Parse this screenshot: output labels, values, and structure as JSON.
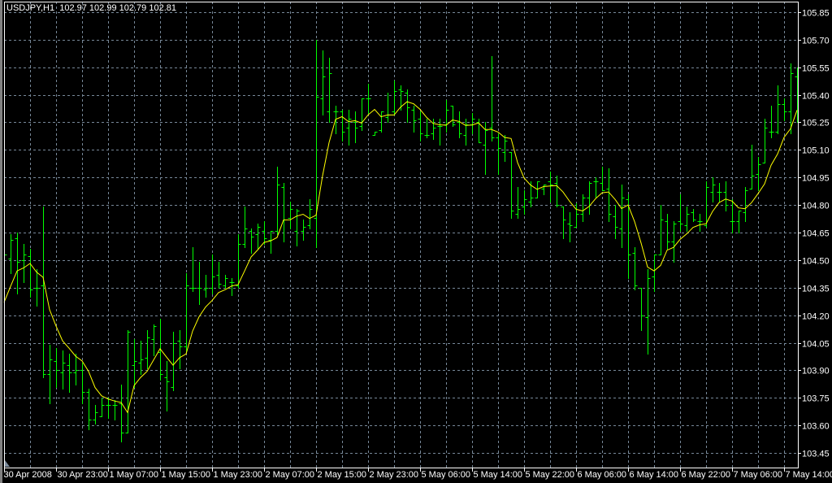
{
  "header": {
    "symbol_label": "USDJPY,H1",
    "ohlc_readout": "102.97 102.99 102.79 102.81"
  },
  "colors": {
    "background": "#000000",
    "bars": "#00ff00",
    "ma": "#ffff00",
    "grid": "#778899",
    "axis": "#ffffff"
  },
  "chart_data": {
    "type": "ohlc",
    "title": "USDJPY,H1",
    "timeframe": "H1",
    "ylim": [
      103.45,
      105.85
    ],
    "yticks": [
      "105.85",
      "105.70",
      "105.55",
      "105.40",
      "105.25",
      "105.10",
      "104.95",
      "104.80",
      "104.65",
      "104.50",
      "104.35",
      "104.20",
      "104.05",
      "103.90",
      "103.75",
      "103.60",
      "103.45"
    ],
    "xtick_labels": [
      "30 Apr 2008",
      "30 Apr 23:00",
      "1 May 07:00",
      "1 May 15:00",
      "1 May 23:00",
      "2 May 07:00",
      "2 May 15:00",
      "2 May 23:00",
      "5 May 06:00",
      "5 May 14:00",
      "5 May 22:00",
      "6 May 06:00",
      "6 May 14:00",
      "6 May 22:00",
      "7 May 06:00",
      "7 May 14:00"
    ],
    "xtick_every_bars": 8,
    "grid": true,
    "bar_fields": [
      "open",
      "high",
      "low",
      "close"
    ],
    "bars": [
      [
        104.59,
        104.64,
        104.43,
        104.53
      ],
      [
        104.51,
        104.64,
        104.43,
        104.61
      ],
      [
        104.62,
        104.65,
        104.32,
        104.49
      ],
      [
        104.5,
        104.59,
        104.38,
        104.53
      ],
      [
        104.52,
        104.56,
        104.3,
        104.34
      ],
      [
        104.35,
        104.45,
        104.25,
        104.35
      ],
      [
        104.36,
        104.79,
        103.86,
        103.88
      ],
      [
        103.88,
        104.04,
        103.72,
        103.96
      ],
      [
        103.95,
        104.02,
        103.81,
        103.9
      ],
      [
        103.89,
        104.01,
        103.8,
        103.94
      ],
      [
        103.93,
        103.99,
        103.78,
        103.89
      ],
      [
        103.89,
        103.99,
        103.82,
        103.9
      ],
      [
        103.9,
        103.94,
        103.72,
        103.78
      ],
      [
        103.78,
        103.8,
        103.58,
        103.63
      ],
      [
        103.63,
        103.71,
        103.61,
        103.67
      ],
      [
        103.65,
        103.75,
        103.65,
        103.71
      ],
      [
        103.71,
        103.75,
        103.64,
        103.71
      ],
      [
        103.71,
        103.74,
        103.63,
        103.71
      ],
      [
        103.72,
        103.82,
        103.51,
        103.56
      ],
      [
        103.56,
        104.12,
        103.56,
        104.11
      ],
      [
        103.93,
        104.07,
        103.81,
        103.95
      ],
      [
        103.94,
        104.06,
        103.88,
        103.96
      ],
      [
        103.97,
        104.12,
        103.91,
        104.08
      ],
      [
        104.07,
        104.15,
        103.98,
        104.14
      ],
      [
        104.0,
        104.18,
        103.85,
        103.88
      ],
      [
        103.86,
        103.95,
        103.68,
        103.84
      ],
      [
        103.81,
        104.11,
        103.79,
        104.05
      ],
      [
        104.06,
        104.12,
        103.91,
        104.03
      ],
      [
        104.03,
        104.43,
        104.0,
        104.36
      ],
      [
        104.35,
        104.57,
        104.33,
        104.35
      ],
      [
        104.35,
        104.49,
        104.26,
        104.35
      ],
      [
        104.34,
        104.42,
        104.3,
        104.35
      ],
      [
        104.35,
        104.53,
        104.32,
        104.41
      ],
      [
        104.42,
        104.49,
        104.35,
        104.37
      ],
      [
        104.36,
        104.42,
        104.35,
        104.4
      ],
      [
        104.38,
        104.4,
        104.31,
        104.38
      ],
      [
        104.36,
        104.64,
        104.35,
        104.59
      ],
      [
        104.59,
        104.79,
        104.57,
        104.67
      ],
      [
        104.66,
        104.67,
        104.54,
        104.63
      ],
      [
        104.64,
        104.7,
        104.56,
        104.68
      ],
      [
        104.66,
        104.71,
        104.59,
        104.62
      ],
      [
        104.61,
        104.66,
        104.54,
        104.66
      ],
      [
        104.66,
        105.01,
        104.64,
        104.91
      ],
      [
        104.9,
        104.92,
        104.6,
        104.72
      ],
      [
        104.73,
        104.82,
        104.67,
        104.78
      ],
      [
        104.66,
        104.78,
        104.58,
        104.77
      ],
      [
        104.66,
        104.72,
        104.61,
        104.68
      ],
      [
        104.69,
        104.83,
        104.67,
        104.78
      ],
      [
        104.73,
        105.7,
        104.57,
        105.39
      ],
      [
        105.38,
        105.64,
        105.29,
        105.5
      ],
      [
        105.31,
        105.6,
        105.25,
        105.52
      ],
      [
        105.31,
        105.34,
        105.19,
        105.31
      ],
      [
        105.31,
        105.32,
        105.15,
        105.2
      ],
      [
        105.22,
        105.32,
        105.13,
        105.27
      ],
      [
        105.25,
        105.31,
        105.14,
        105.22
      ],
      [
        105.23,
        105.38,
        105.21,
        105.38
      ],
      [
        105.38,
        105.46,
        105.3,
        105.38
      ],
      [
        105.18,
        105.2,
        105.18,
        105.2
      ],
      [
        105.21,
        105.31,
        105.2,
        105.31
      ],
      [
        105.28,
        105.41,
        105.25,
        105.29
      ],
      [
        105.31,
        105.48,
        105.29,
        105.42
      ],
      [
        105.43,
        105.45,
        105.32,
        105.42
      ],
      [
        105.41,
        105.43,
        105.25,
        105.33
      ],
      [
        105.32,
        105.34,
        105.2,
        105.26
      ],
      [
        105.27,
        105.31,
        105.15,
        105.19
      ],
      [
        105.18,
        105.27,
        105.17,
        105.18
      ],
      [
        105.19,
        105.27,
        105.16,
        105.22
      ],
      [
        105.23,
        105.27,
        105.13,
        105.23
      ],
      [
        105.24,
        105.37,
        105.2,
        105.32
      ],
      [
        105.34,
        105.34,
        105.23,
        105.24
      ],
      [
        105.25,
        105.31,
        105.17,
        105.19
      ],
      [
        105.18,
        105.27,
        105.13,
        105.24
      ],
      [
        105.24,
        105.3,
        105.19,
        105.27
      ],
      [
        105.25,
        105.27,
        105.14,
        105.14
      ],
      [
        105.13,
        105.25,
        104.97,
        105.21
      ],
      [
        105.22,
        105.61,
        105.15,
        105.17
      ],
      [
        105.17,
        105.19,
        104.97,
        105.11
      ],
      [
        105.09,
        105.18,
        105.04,
        105.15
      ],
      [
        105.09,
        105.09,
        104.73,
        104.77
      ],
      [
        104.75,
        104.9,
        104.73,
        104.78
      ],
      [
        104.79,
        104.88,
        104.75,
        104.83
      ],
      [
        104.82,
        104.93,
        104.79,
        104.84
      ],
      [
        104.84,
        104.93,
        104.84,
        104.93
      ],
      [
        104.89,
        104.91,
        104.86,
        104.91
      ],
      [
        104.93,
        104.98,
        104.82,
        104.91
      ],
      [
        104.92,
        104.96,
        104.79,
        104.8
      ],
      [
        104.79,
        104.79,
        104.62,
        104.72
      ],
      [
        104.7,
        104.76,
        104.6,
        104.69
      ],
      [
        104.68,
        104.81,
        104.68,
        104.75
      ],
      [
        104.75,
        104.86,
        104.71,
        104.84
      ],
      [
        104.84,
        104.93,
        104.75,
        104.92
      ],
      [
        104.93,
        104.95,
        104.84,
        104.93
      ],
      [
        104.92,
        105.01,
        104.88,
        104.88
      ],
      [
        104.89,
        105.0,
        104.71,
        104.75
      ],
      [
        104.74,
        104.8,
        104.62,
        104.68
      ],
      [
        104.67,
        104.91,
        104.57,
        104.84
      ],
      [
        104.83,
        104.86,
        104.4,
        104.53
      ],
      [
        104.54,
        104.57,
        104.34,
        104.36
      ],
      [
        104.35,
        104.35,
        104.12,
        104.2
      ],
      [
        104.19,
        104.45,
        103.99,
        104.4
      ],
      [
        104.41,
        104.53,
        104.33,
        104.53
      ],
      [
        104.53,
        104.8,
        104.53,
        104.72
      ],
      [
        104.71,
        104.75,
        104.56,
        104.6
      ],
      [
        104.6,
        104.71,
        104.49,
        104.7
      ],
      [
        104.71,
        104.86,
        104.66,
        104.7
      ],
      [
        104.69,
        104.79,
        104.66,
        104.75
      ],
      [
        104.76,
        104.78,
        104.71,
        104.72
      ],
      [
        104.71,
        104.75,
        104.66,
        104.71
      ],
      [
        104.69,
        104.93,
        104.68,
        104.9
      ],
      [
        104.87,
        104.95,
        104.82,
        104.91
      ],
      [
        104.87,
        104.92,
        104.82,
        104.87
      ],
      [
        104.87,
        104.93,
        104.77,
        104.8
      ],
      [
        104.71,
        104.83,
        104.65,
        104.71
      ],
      [
        104.71,
        104.77,
        104.65,
        104.77
      ],
      [
        104.76,
        104.9,
        104.71,
        104.88
      ],
      [
        104.89,
        105.13,
        104.89,
        104.96
      ],
      [
        104.97,
        105.06,
        104.88,
        105.02
      ],
      [
        105.03,
        105.27,
        105.03,
        105.22
      ],
      [
        105.2,
        105.34,
        105.17,
        105.2
      ],
      [
        105.2,
        105.45,
        105.19,
        105.35
      ],
      [
        105.35,
        105.38,
        105.26,
        105.31
      ],
      [
        105.31,
        105.57,
        105.19,
        105.52
      ],
      [
        105.5,
        105.55,
        105.25,
        105.35
      ]
    ],
    "ma": {
      "type": "EMA",
      "period": 5,
      "seed": 104.27
    }
  }
}
